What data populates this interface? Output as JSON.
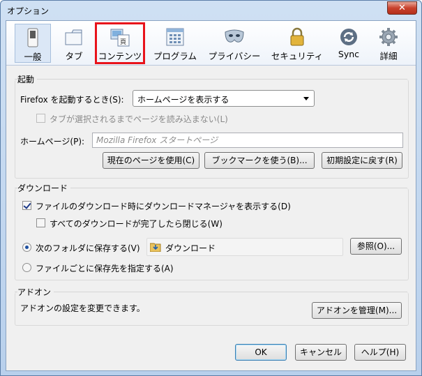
{
  "window": {
    "title": "オプション",
    "close_label": "✕"
  },
  "toolbar": {
    "panes": [
      {
        "label": "一般",
        "icon": "switch-icon"
      },
      {
        "label": "タブ",
        "icon": "tab-icon"
      },
      {
        "label": "コンテンツ",
        "icon": "content-icon"
      },
      {
        "label": "プログラム",
        "icon": "applications-icon"
      },
      {
        "label": "プライバシー",
        "icon": "mask-icon"
      },
      {
        "label": "セキュリティ",
        "icon": "padlock-icon"
      },
      {
        "label": "Sync",
        "icon": "sync-icon"
      },
      {
        "label": "詳細",
        "icon": "gear-icon"
      }
    ],
    "selected": "一般",
    "highlighted": "コンテンツ"
  },
  "startup": {
    "heading": "起動",
    "when_starts_label": "Firefox を起動するとき(S):",
    "when_starts_value": "ホームページを表示する",
    "dont_load_tabs_label": "タブが選択されるまでページを読み込まない(L)",
    "dont_load_tabs_checked": false,
    "homepage_label": "ホームページ(P):",
    "homepage_placeholder": "Mozilla Firefox スタートページ",
    "use_current_label": "現在のページを使用(C)",
    "use_bookmark_label": "ブックマークを使う(B)...",
    "restore_default_label": "初期設定に戻す(R)"
  },
  "downloads": {
    "heading": "ダウンロード",
    "show_manager_label": "ファイルのダウンロード時にダウンロードマネージャを表示する(D)",
    "show_manager_checked": true,
    "close_when_done_label": "すべてのダウンロードが完了したら閉じる(W)",
    "close_when_done_checked": false,
    "save_to_label": "次のフォルダに保存する(V)",
    "save_to_checked": true,
    "folder_name": "ダウンロード",
    "browse_label": "参照(O)...",
    "always_ask_label": "ファイルごとに保存先を指定する(A)",
    "always_ask_checked": false
  },
  "addons": {
    "heading": "アドオン",
    "description": "アドオンの設定を変更できます。",
    "manage_label": "アドオンを管理(M)..."
  },
  "footer": {
    "ok_label": "OK",
    "cancel_label": "キャンセル",
    "help_label": "ヘルプ(H)"
  },
  "colors": {
    "highlight": "#e8131b",
    "selected_pane": "#dbe7f6"
  }
}
